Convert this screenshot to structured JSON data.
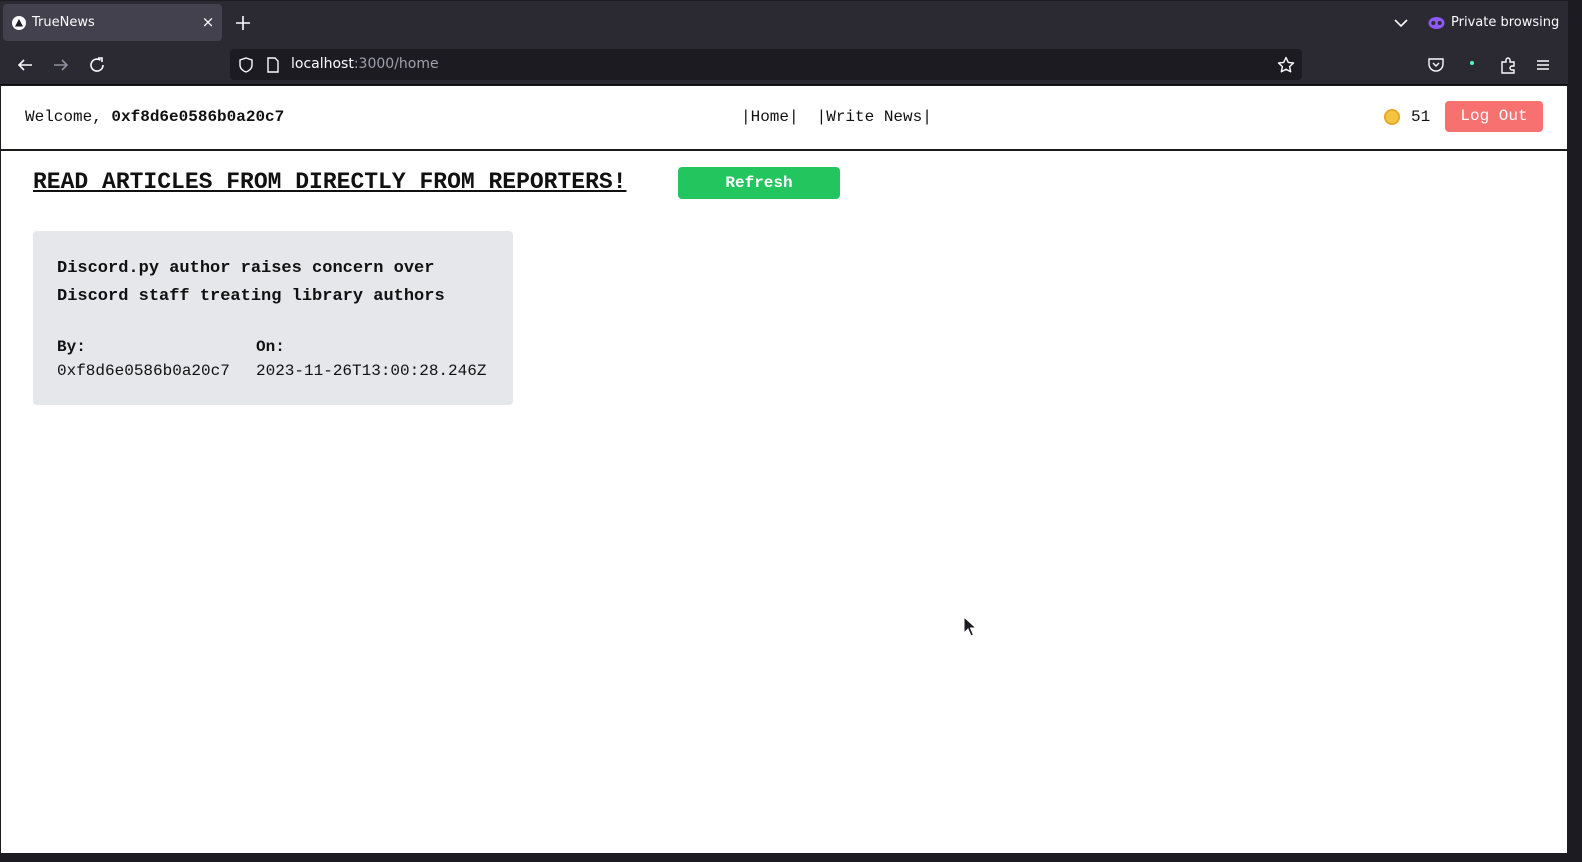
{
  "browser": {
    "tab": {
      "title": "TrueNews",
      "close": "×"
    },
    "private_label": "Private browsing",
    "url": {
      "host": "localhost",
      "rest": ":3000/home"
    }
  },
  "header": {
    "welcome_prefix": "Welcome, ",
    "user": "0xf8d6e0586b0a20c7",
    "nav": {
      "home": "|Home|",
      "write": "|Write News|"
    },
    "balance": "51",
    "logout": "Log Out"
  },
  "main": {
    "headline": "READ ARTICLES FROM DIRECTLY FROM REPORTERS!",
    "refresh": "Refresh",
    "articles": [
      {
        "title": "Discord.py author raises concern over Discord staff treating library authors",
        "by_label": "By:",
        "by": "0xf8d6e0586b0a20c7",
        "on_label": "On:",
        "on": "2023-11-26T13:00:28.246Z"
      }
    ]
  },
  "colors": {
    "refresh": "#22c55e",
    "logout": "#f87171",
    "card": "#e5e7eb",
    "chrome": "#2b2a33"
  }
}
